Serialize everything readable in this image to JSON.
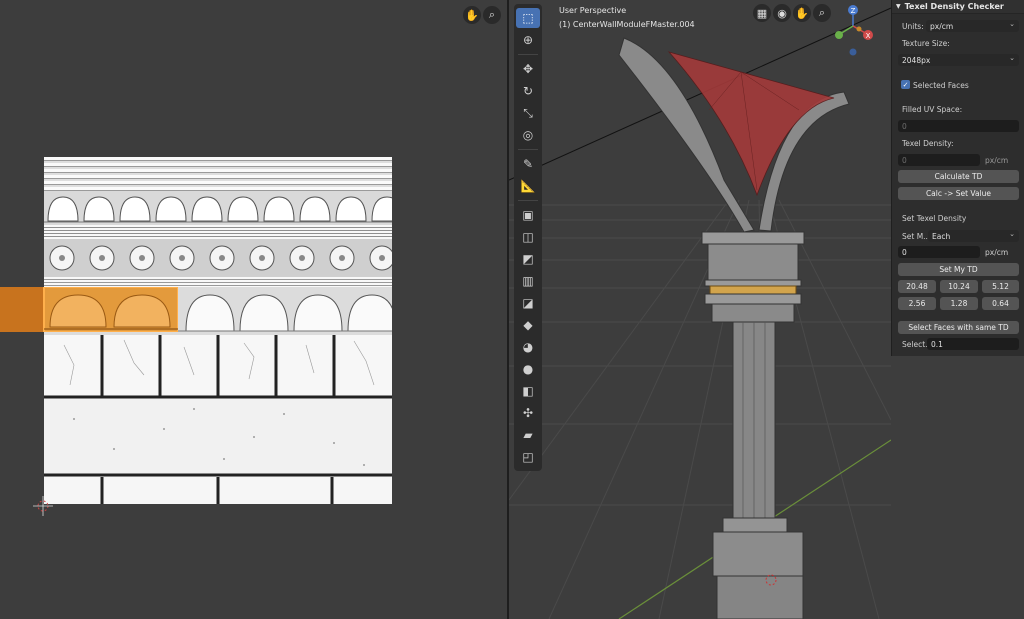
{
  "viewport": {
    "perspective_label": "User Perspective",
    "object_label": "(1) CenterWallModuleFMaster.004"
  },
  "gizmo": {
    "z": "Z",
    "x": "X"
  },
  "sidebar": {
    "title": "Texel Density Checker",
    "units_label": "Units:",
    "units_value": "px/cm",
    "texture_size_label": "Texture Size:",
    "texture_size_value": "2048px",
    "selected_faces_label": "Selected Faces",
    "selected_faces_checked": true,
    "filled_uv_label": "Filled UV Space:",
    "filled_uv_value": "0",
    "texel_density_label": "Texel Density:",
    "texel_density_value": "0",
    "texel_density_unit": "px/cm",
    "calculate_button": "Calculate TD",
    "calc_set_button": "Calc -> Set Value",
    "set_texel_label": "Set Texel Density",
    "set_method_label": "Set M..",
    "set_method_value": "Each",
    "set_value": "0",
    "set_value_unit": "px/cm",
    "set_my_td_button": "Set My TD",
    "presets": [
      "20.48",
      "10.24",
      "5.12",
      "2.56",
      "1.28",
      "0.64"
    ],
    "select_faces_button": "Select Faces with same TD",
    "select_label": "Select..",
    "select_value": "0.1"
  },
  "colors": {
    "accent": "#4772b3",
    "selection_orange": "#e38a2a",
    "face_red": "#b03a3a",
    "band_gold": "#d2a44c"
  }
}
